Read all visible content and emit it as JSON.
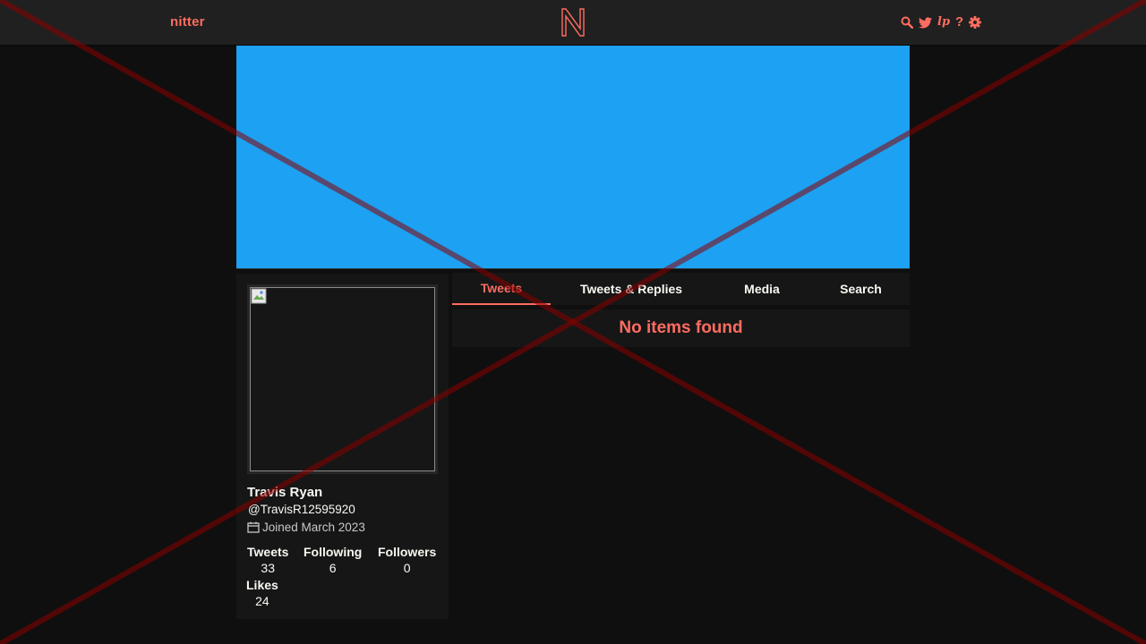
{
  "navbar": {
    "brand": "nitter",
    "icons": [
      "search-icon",
      "twitter-bird-icon",
      "libreplanet-icon",
      "help-icon",
      "gear-icon"
    ],
    "lp_label": "lp",
    "help_label": "?"
  },
  "colors": {
    "accent": "#ff6c60",
    "banner": "#1da1f2",
    "background": "#0f0f0f",
    "panel": "#161616",
    "overlay_x": "#8b0000"
  },
  "profile": {
    "fullname": "Travis Ryan",
    "username": "@TravisR12595920",
    "joined": "Joined March 2023",
    "stats": {
      "tweets_label": "Tweets",
      "tweets": "33",
      "following_label": "Following",
      "following": "6",
      "followers_label": "Followers",
      "followers": "0",
      "likes_label": "Likes",
      "likes": "24"
    }
  },
  "tabs": [
    {
      "label": "Tweets",
      "active": true
    },
    {
      "label": "Tweets & Replies",
      "active": false
    },
    {
      "label": "Media",
      "active": false
    },
    {
      "label": "Search",
      "active": false
    }
  ],
  "timeline": {
    "empty_message": "No items found"
  }
}
